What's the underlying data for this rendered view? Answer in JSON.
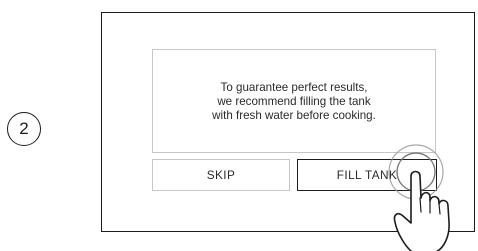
{
  "step": {
    "number": "2"
  },
  "dialog": {
    "message_lines": [
      "To guarantee perfect results,",
      "we recommend filling the tank",
      "with fresh water before cooking."
    ],
    "skip_label": "SKIP",
    "fill_label": "FILL TANK"
  },
  "icons": {
    "touch_indicator": "finger-tap-icon"
  }
}
